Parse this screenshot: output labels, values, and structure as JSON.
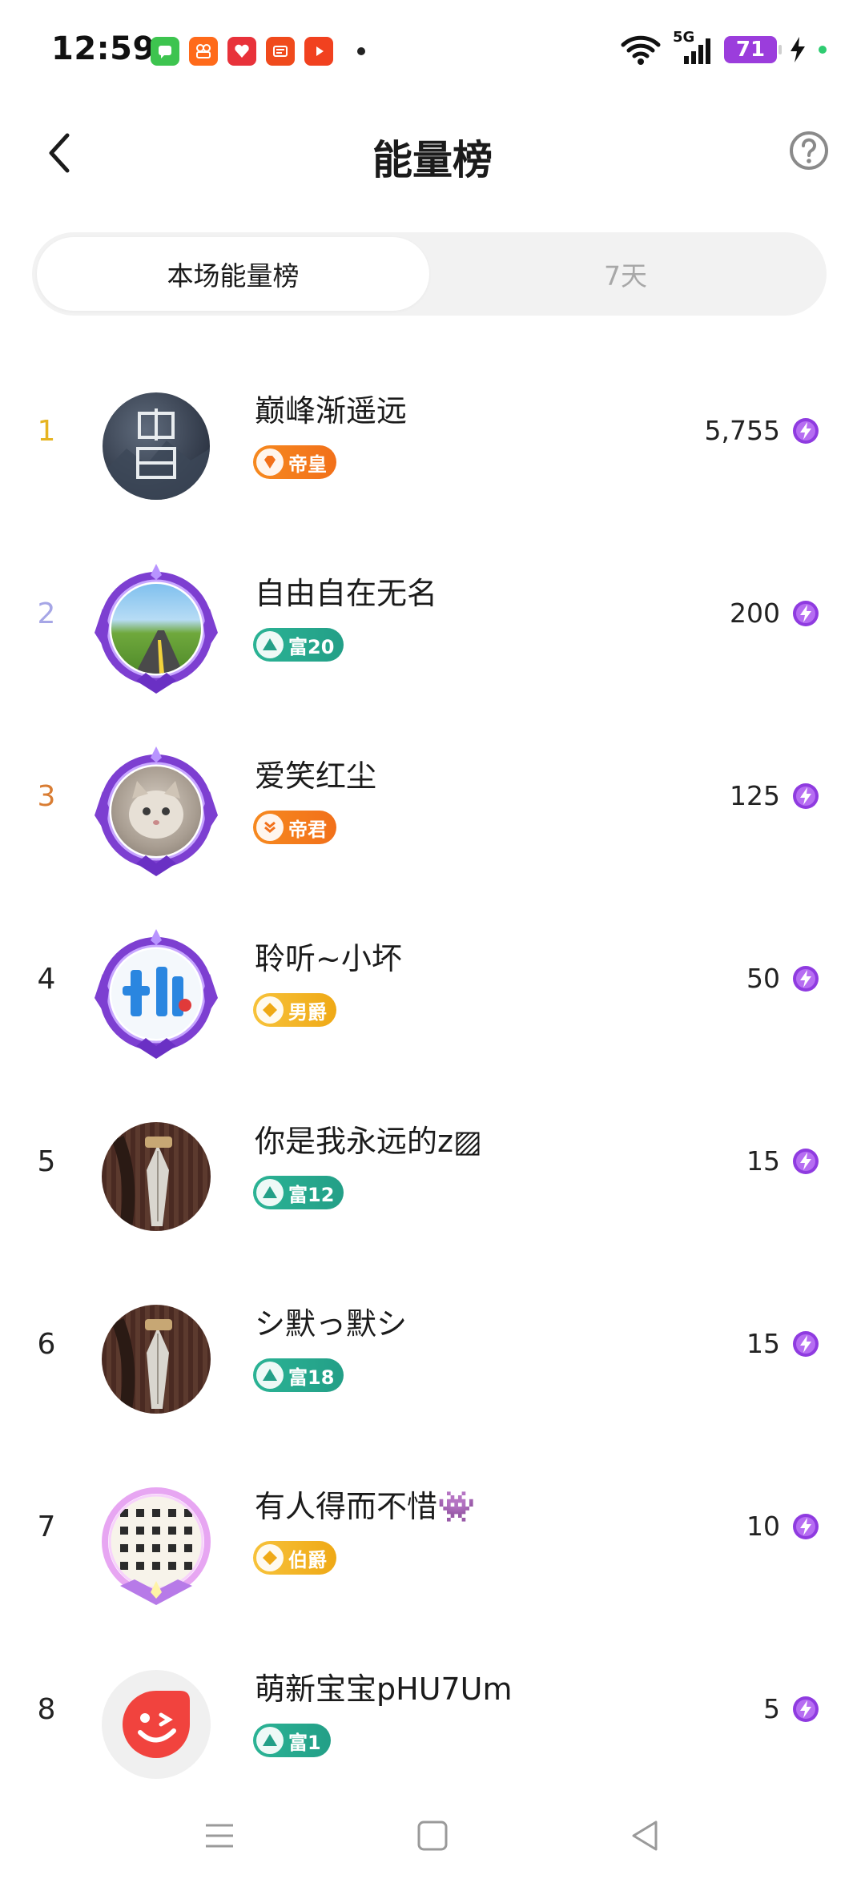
{
  "status_bar": {
    "time": "12:59",
    "network": "5G",
    "battery": "71",
    "icons": [
      "messages-icon",
      "app-icon",
      "shopping-icon",
      "news-icon",
      "video-icon"
    ]
  },
  "header": {
    "title": "能量榜"
  },
  "tabs": [
    {
      "label": "本场能量榜",
      "active": true
    },
    {
      "label": "7天",
      "active": false
    }
  ],
  "colors": {
    "rank1": "#e6b422",
    "rank2": "#a6a6e6",
    "rank3": "#d97d33",
    "default_rank": "#222222",
    "energy_icon": "#8f3be0"
  },
  "rankings": [
    {
      "rank": "1",
      "name": "巅峰渐遥远",
      "badge": "帝皇",
      "badge_color": "#f07a1c",
      "score": "5,755"
    },
    {
      "rank": "2",
      "name": "自由自在无名",
      "badge": "富20",
      "badge_color": "#2aa88e",
      "score": "200"
    },
    {
      "rank": "3",
      "name": "爱笑红尘",
      "badge": "帝君",
      "badge_color": "#f07a1c",
      "score": "125"
    },
    {
      "rank": "4",
      "name": "聆听~小坏",
      "badge": "男爵",
      "badge_color": "#f3b21e",
      "score": "50"
    },
    {
      "rank": "5",
      "name": "你是我永远的z▨",
      "badge": "富12",
      "badge_color": "#2aa88e",
      "score": "15"
    },
    {
      "rank": "6",
      "name": "シ默っ默シ",
      "badge": "富18",
      "badge_color": "#2aa88e",
      "score": "15"
    },
    {
      "rank": "7",
      "name": "有人得而不惜👾",
      "badge": "伯爵",
      "badge_color": "#f3b21e",
      "score": "10"
    },
    {
      "rank": "8",
      "name": "萌新宝宝pHU7Um",
      "badge": "富1",
      "badge_color": "#2aa88e",
      "score": "5"
    }
  ]
}
